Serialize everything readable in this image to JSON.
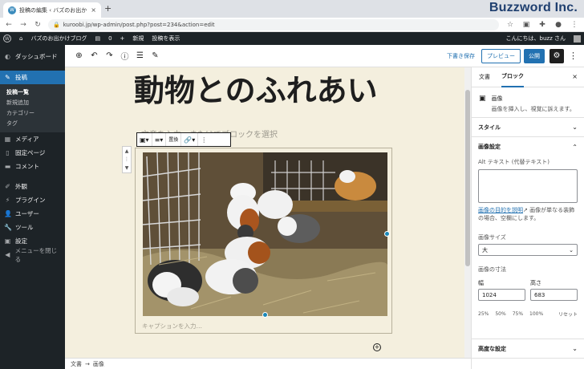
{
  "browser": {
    "tab_title": "投稿の編集 ‹ バズのお出かけブログ — WordPress",
    "tab_close": "×",
    "new_tab": "+",
    "url": "kuroobi.jp/wp-admin/post.php?post=234&action=edit",
    "watermark": "Buzzword Inc."
  },
  "adminbar": {
    "site_name": "バズのお出かけブログ",
    "comments_count": "0",
    "new_label": "新規",
    "view_post": "投稿を表示",
    "greeting": "こんにちは、buzz さん"
  },
  "sidebar": {
    "dashboard": "ダッシュボード",
    "posts": "投稿",
    "sub_all_posts": "投稿一覧",
    "sub_new": "新規追加",
    "sub_categories": "カテゴリー",
    "sub_tags": "タグ",
    "media": "メディア",
    "pages": "固定ページ",
    "comments": "コメント",
    "appearance": "外観",
    "plugins": "プラグイン",
    "users": "ユーザー",
    "tools": "ツール",
    "settings": "設定",
    "collapse": "メニューを閉じる"
  },
  "editor": {
    "save_draft": "下書き保存",
    "preview": "プレビュー",
    "publish": "公開",
    "post_title": "動物とのふれあい",
    "block_hint": "文章を入力、またはでブロックを選択",
    "replace_label": "置換",
    "caption_placeholder": "キャプションを入力…",
    "breadcrumb_doc": "文書",
    "breadcrumb_sep": "→",
    "breadcrumb_block": "画像"
  },
  "panel": {
    "tab_document": "文書",
    "tab_block": "ブロック",
    "close": "×",
    "block_name": "画像",
    "block_desc": "画像を挿入し、視覚に訴えます。",
    "styles": "スタイル",
    "image_settings": "画像設定",
    "alt_label": "Alt テキスト (代替テキスト)",
    "alt_help_link": "画像の目的を説明",
    "alt_help_text": "画像が単なる装飾の場合、空欄にします。",
    "size_label": "画像サイズ",
    "size_value": "大",
    "dimensions_label": "画像の寸法",
    "width_label": "幅",
    "height_label": "高さ",
    "width_value": "1024",
    "height_value": "683",
    "pct_25": "25%",
    "pct_50": "50%",
    "pct_75": "75%",
    "pct_100": "100%",
    "reset": "リセット",
    "advanced": "高度な設定"
  }
}
